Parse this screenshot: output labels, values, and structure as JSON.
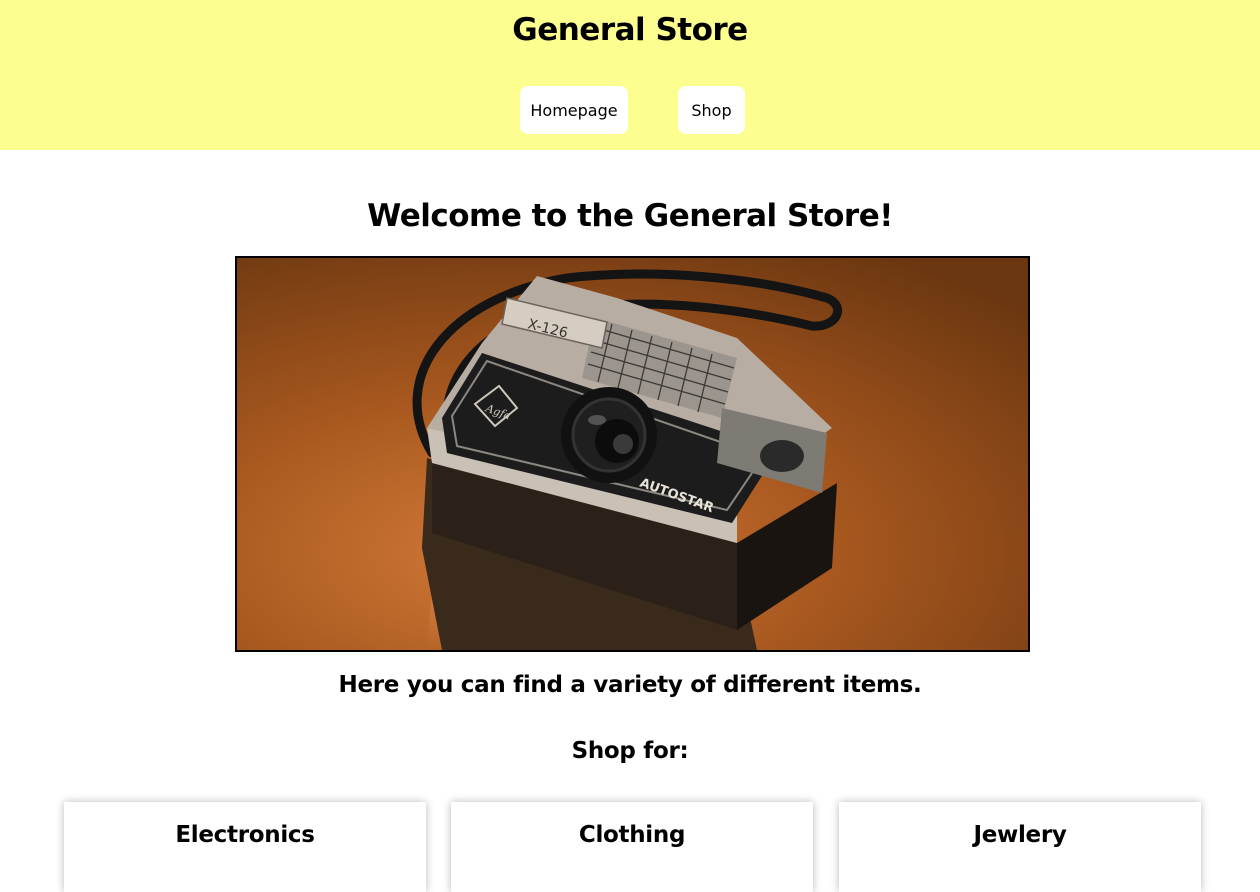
{
  "header": {
    "title": "General Store",
    "nav": [
      {
        "label": "Homepage"
      },
      {
        "label": "Shop"
      }
    ]
  },
  "main": {
    "welcome": "Welcome to the General Store!",
    "hero": {
      "model_label": "X-126",
      "brand_label": "AUTOSTAR"
    },
    "tagline": "Here you can find a variety of different items.",
    "shop_for": "Shop for:",
    "categories": [
      {
        "label": "Electronics"
      },
      {
        "label": "Clothing"
      },
      {
        "label": "Jewlery"
      }
    ]
  },
  "colors": {
    "header_bg": "#fcff90",
    "photo_bg": "#a45a22"
  }
}
